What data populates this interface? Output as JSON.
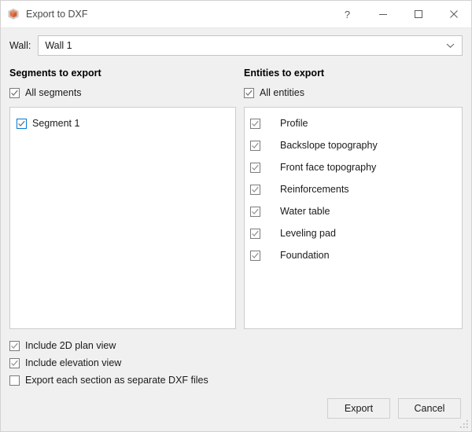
{
  "window": {
    "title": "Export to DXF",
    "icon": "app-cube-icon",
    "controls": [
      {
        "name": "help-button",
        "glyph": "?"
      },
      {
        "name": "minimize-button",
        "glyph": "─"
      },
      {
        "name": "maximize-button",
        "glyph": "□"
      },
      {
        "name": "close-button",
        "glyph": "✕"
      }
    ]
  },
  "wall": {
    "label": "Wall:",
    "selected": "Wall 1",
    "options": [
      "Wall 1"
    ]
  },
  "segments": {
    "group_title": "Segments to export",
    "all_label": "All segments",
    "all_checked": true,
    "items": [
      {
        "label": "Segment 1",
        "checked": true
      }
    ]
  },
  "entities": {
    "group_title": "Entities to export",
    "all_label": "All entities",
    "all_checked": true,
    "items": [
      {
        "label": "Profile",
        "checked": true
      },
      {
        "label": "Backslope topography",
        "checked": true
      },
      {
        "label": "Front face topography",
        "checked": true
      },
      {
        "label": "Reinforcements",
        "checked": true
      },
      {
        "label": "Water table",
        "checked": true
      },
      {
        "label": "Leveling pad",
        "checked": true
      },
      {
        "label": "Foundation",
        "checked": true
      }
    ]
  },
  "options": [
    {
      "label": "Include 2D plan view",
      "checked": true
    },
    {
      "label": "Include elevation view",
      "checked": true
    },
    {
      "label": "Export each section as separate DXF files",
      "checked": false
    }
  ],
  "footer": {
    "export_label": "Export",
    "cancel_label": "Cancel"
  },
  "colors": {
    "accent": "#0078d7",
    "check": "#6d6d6d",
    "body": "#f0f0f0",
    "titlebar": "#ffffff"
  }
}
